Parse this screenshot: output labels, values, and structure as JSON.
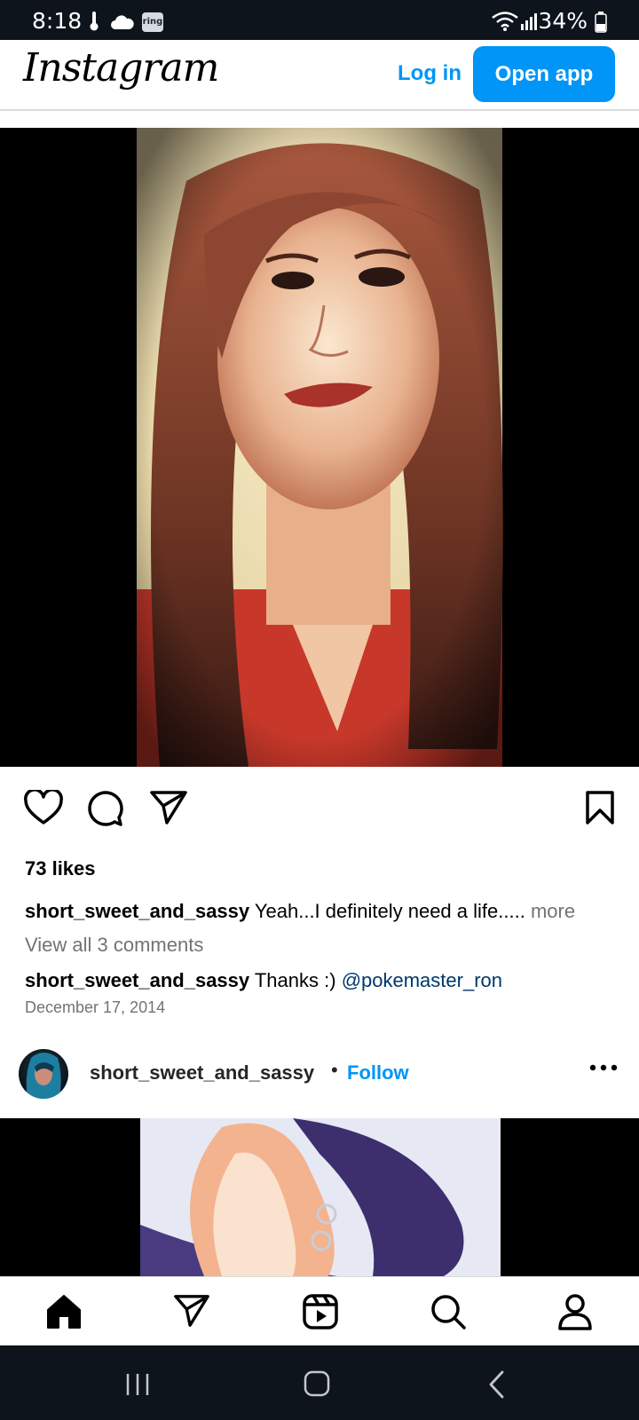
{
  "status_bar": {
    "time": "8:18",
    "ring_label": "ring",
    "battery_percent": "34%",
    "icons": [
      "thermometer-icon",
      "cloud-icon",
      "ring-app-icon",
      "wifi-icon",
      "signal-icon",
      "battery-icon"
    ]
  },
  "header": {
    "logo_text": "Instagram",
    "login_label": "Log in",
    "open_app_label": "Open app",
    "accent_color": "#0095f6"
  },
  "post": {
    "likes": "73 likes",
    "caption_user": "short_sweet_and_sassy",
    "caption_text": "Yeah...I definitely need a life.....",
    "more_label": "more",
    "view_comments": "View all 3 comments",
    "comment_user": "short_sweet_and_sassy",
    "comment_text": "Thanks :)",
    "comment_mention": "@pokemaster_ron",
    "date": "December 17, 2014",
    "actions": [
      "heart-icon",
      "comment-icon",
      "share-icon",
      "bookmark-icon"
    ]
  },
  "next_post": {
    "username": "short_sweet_and_sassy",
    "separator": "•",
    "follow_label": "Follow"
  },
  "bottom_tabs": [
    "home-icon",
    "direct-icon",
    "reels-icon",
    "search-icon",
    "profile-icon"
  ],
  "system_nav": [
    "recents-icon",
    "home-nav-icon",
    "back-icon"
  ]
}
